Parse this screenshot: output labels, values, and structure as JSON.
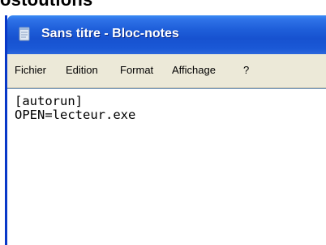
{
  "window": {
    "title": "Sans titre - Bloc-notes",
    "titlebar_color": "#1f5fda",
    "icon": "notepad-icon"
  },
  "menubar": {
    "items": [
      {
        "label": "Fichier"
      },
      {
        "label": "Edition"
      },
      {
        "label": "Format"
      },
      {
        "label": "Affichage"
      },
      {
        "label": "?"
      }
    ]
  },
  "editor": {
    "lines": [
      "[autorun]",
      "OPEN=lecteur.exe"
    ]
  }
}
